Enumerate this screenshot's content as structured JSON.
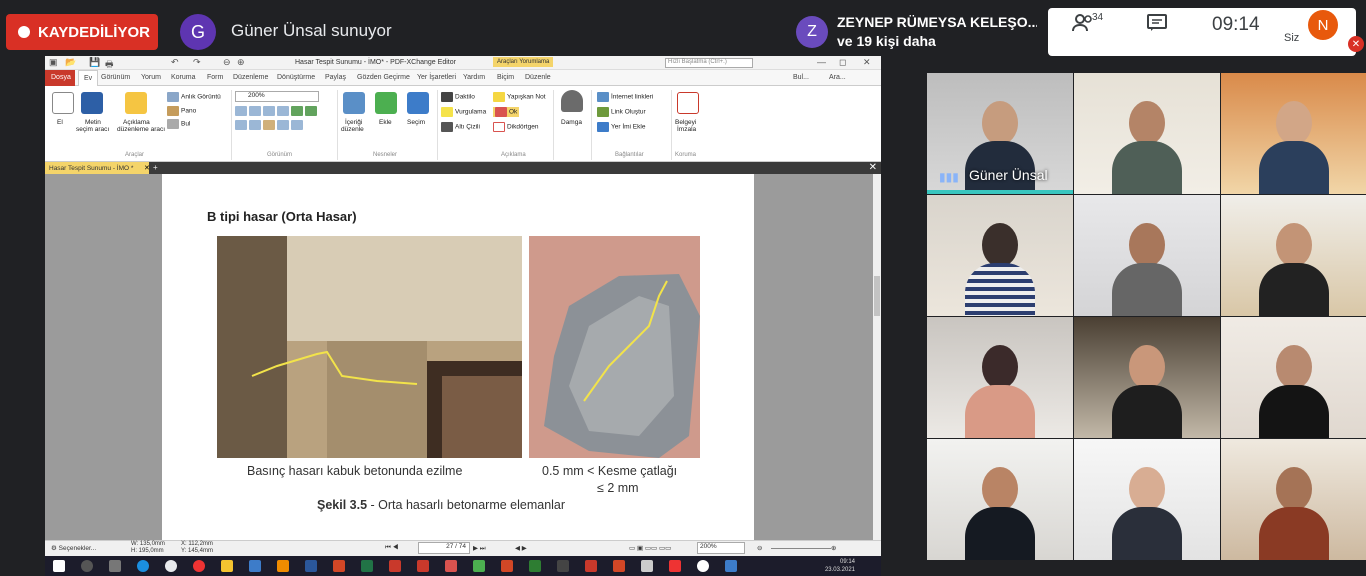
{
  "meet": {
    "recording_label": "KAYDEDİLİYOR",
    "presenter_initial": "G",
    "presenting_text": "Güner Ünsal sunuyor",
    "participant_initial": "Z",
    "participant_name": "ZEYNEP RÜMEYSA KELEŞO...",
    "participant_more": "ve 19 kişi daha",
    "people_count": "34",
    "clock": "09:14",
    "self_label": "Siz",
    "self_initial": "N"
  },
  "pdf": {
    "window_title": "Hasar Tespit Sunumu - İMO* - PDF-XChange Editor",
    "context_tab": "Araçları Yorumlama",
    "search_placeholder": "Hızlı Başlatma (Ctrl+.)",
    "tabs": [
      "Dosya",
      "Ev",
      "Görünüm",
      "Yorum",
      "Koruma",
      "Form",
      "Düzenleme",
      "Dönüştürme",
      "Paylaş",
      "Gözden Geçirme",
      "Yer İşaretleri",
      "Yardım",
      "Biçim",
      "Düzenle"
    ],
    "right_tools": [
      "Bul...",
      "Ara..."
    ],
    "ribbon": {
      "el": "El",
      "metin": "Metin",
      "metin_sub": "seçim aracı",
      "aciklama": "Açıklama",
      "aciklama_sub": "düzenleme aracı",
      "anlik": "Anlık Görüntü",
      "pano": "Pano",
      "bul": "Bul",
      "araclar": "Araçlar",
      "zoom": "200%",
      "gorunum": "Görünüm",
      "icerigi": "İçeriği",
      "icerigi_sub": "düzenle",
      "ekle": "Ekle",
      "secim": "Seçim",
      "nesneler": "Nesneler",
      "daktilo": "Daktilo",
      "vurgulama": "Vurgulama",
      "alti_cizili": "Altı Çizili",
      "yapiskan": "Yapışkan Not",
      "ok": "Ok",
      "dikdortgen": "Dikdörtgen",
      "aciklama_grp": "Açıklama",
      "damga": "Damga",
      "internet": "İnternet linkleri",
      "link": "Link Oluştur",
      "yer_imi": "Yer İmi Ekle",
      "baglantilar": "Bağlantılar",
      "belgeyi": "Belgeyi",
      "imzala": "İmzala",
      "koruma": "Koruma"
    },
    "doc_tab": "Hasar Tespit Sunumu - İMO *",
    "page": {
      "heading": "B tipi hasar (Orta Hasar)",
      "caption_left": "Basınç hasarı kabuk betonunda ezilme",
      "caption_right_1": "0.5 mm < Kesme çatlağı",
      "caption_right_2": "≤ 2 mm",
      "figure_label": "Şekil 3.5",
      "figure_text": " - Orta hasarlı betonarme elemanlar"
    },
    "status": {
      "settings": "Seçenekler...",
      "w": "W: 135,0mm",
      "h": "H: 195,0mm",
      "x": "X: 112,2mm",
      "y": "Y: 145,4mm",
      "page_counter": "27 / 74",
      "zoom": "200%"
    },
    "taskbar": {
      "time": "09:14",
      "date": "23.03.2021"
    }
  },
  "grid": {
    "active_name": "Güner Ünsal"
  },
  "colors": {
    "meet_bg": "#202124",
    "recording": "#d93025",
    "active_tile_bar": "#3ac6bf",
    "pdfx_accent": "#f4d46a"
  }
}
